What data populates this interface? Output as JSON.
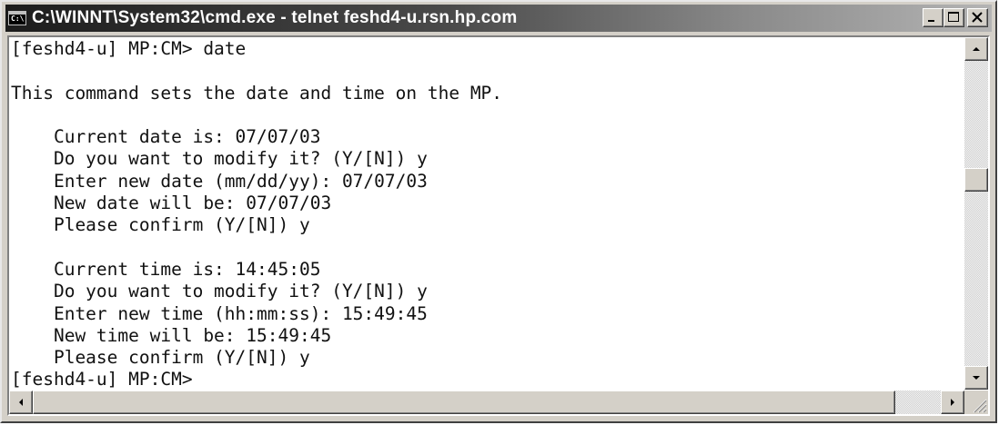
{
  "window": {
    "title": "C:\\WINNT\\System32\\cmd.exe - telnet feshd4-u.rsn.hp.com",
    "icon_text": "C:\\",
    "icon": "console-icon",
    "controls": {
      "minimize_icon": "minimize-icon",
      "maximize_icon": "maximize-icon",
      "close_icon": "close-icon"
    }
  },
  "console": {
    "lines": [
      "[feshd4-u] MP:CM> date",
      "",
      "This command sets the date and time on the MP.",
      "",
      "    Current date is: 07/07/03",
      "    Do you want to modify it? (Y/[N]) y",
      "    Enter new date (mm/dd/yy): 07/07/03",
      "    New date will be: 07/07/03",
      "    Please confirm (Y/[N]) y",
      "",
      "    Current time is: 14:45:05",
      "    Do you want to modify it? (Y/[N]) y",
      "    Enter new time (hh:mm:ss): 15:49:45",
      "    New time will be: 15:49:45",
      "    Please confirm (Y/[N]) y",
      "[feshd4-u] MP:CM>"
    ]
  },
  "scrollbars": {
    "vertical": {
      "up_icon": "arrow-up-icon",
      "down_icon": "arrow-down-icon"
    },
    "horizontal": {
      "left_icon": "arrow-left-icon",
      "right_icon": "arrow-right-icon"
    }
  },
  "colors": {
    "titlebar_start": "#1c1c1c",
    "titlebar_end": "#b4b4b4",
    "chrome": "#d4d0c8",
    "console_bg": "#ffffff",
    "console_text": "#111111"
  }
}
